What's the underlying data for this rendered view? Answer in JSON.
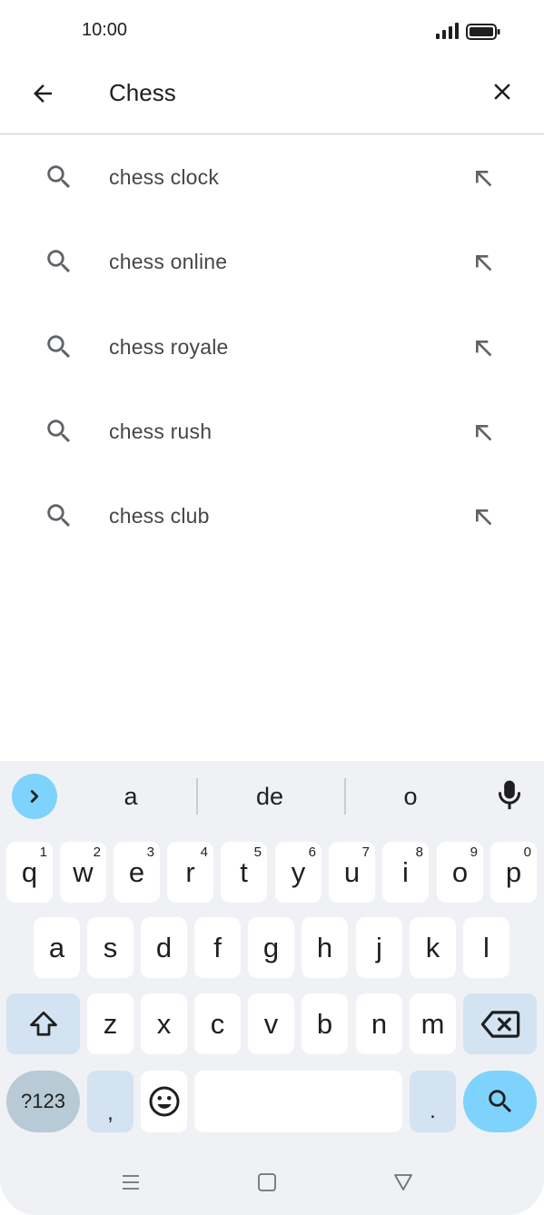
{
  "status_bar": {
    "time": "10:00"
  },
  "search": {
    "query": "Chess",
    "back_icon": "arrow-left-icon",
    "clear_icon": "close-icon"
  },
  "suggestions": [
    {
      "text": "chess clock"
    },
    {
      "text": "chess online"
    },
    {
      "text": "chess royale"
    },
    {
      "text": "chess rush"
    },
    {
      "text": "chess club"
    }
  ],
  "keyboard": {
    "word_suggestions": [
      "a",
      "de",
      "o"
    ],
    "row1": [
      {
        "key": "q",
        "hint": "1"
      },
      {
        "key": "w",
        "hint": "2"
      },
      {
        "key": "e",
        "hint": "3"
      },
      {
        "key": "r",
        "hint": "4"
      },
      {
        "key": "t",
        "hint": "5"
      },
      {
        "key": "y",
        "hint": "6"
      },
      {
        "key": "u",
        "hint": "7"
      },
      {
        "key": "i",
        "hint": "8"
      },
      {
        "key": "o",
        "hint": "9"
      },
      {
        "key": "p",
        "hint": "0"
      }
    ],
    "row2": [
      "a",
      "s",
      "d",
      "f",
      "g",
      "h",
      "j",
      "k",
      "l"
    ],
    "row3": [
      "z",
      "x",
      "c",
      "v",
      "b",
      "n",
      "m"
    ],
    "symbols_label": "?123",
    "comma_label": ",",
    "period_label": ".",
    "accent_color": "#7dd3fc"
  }
}
